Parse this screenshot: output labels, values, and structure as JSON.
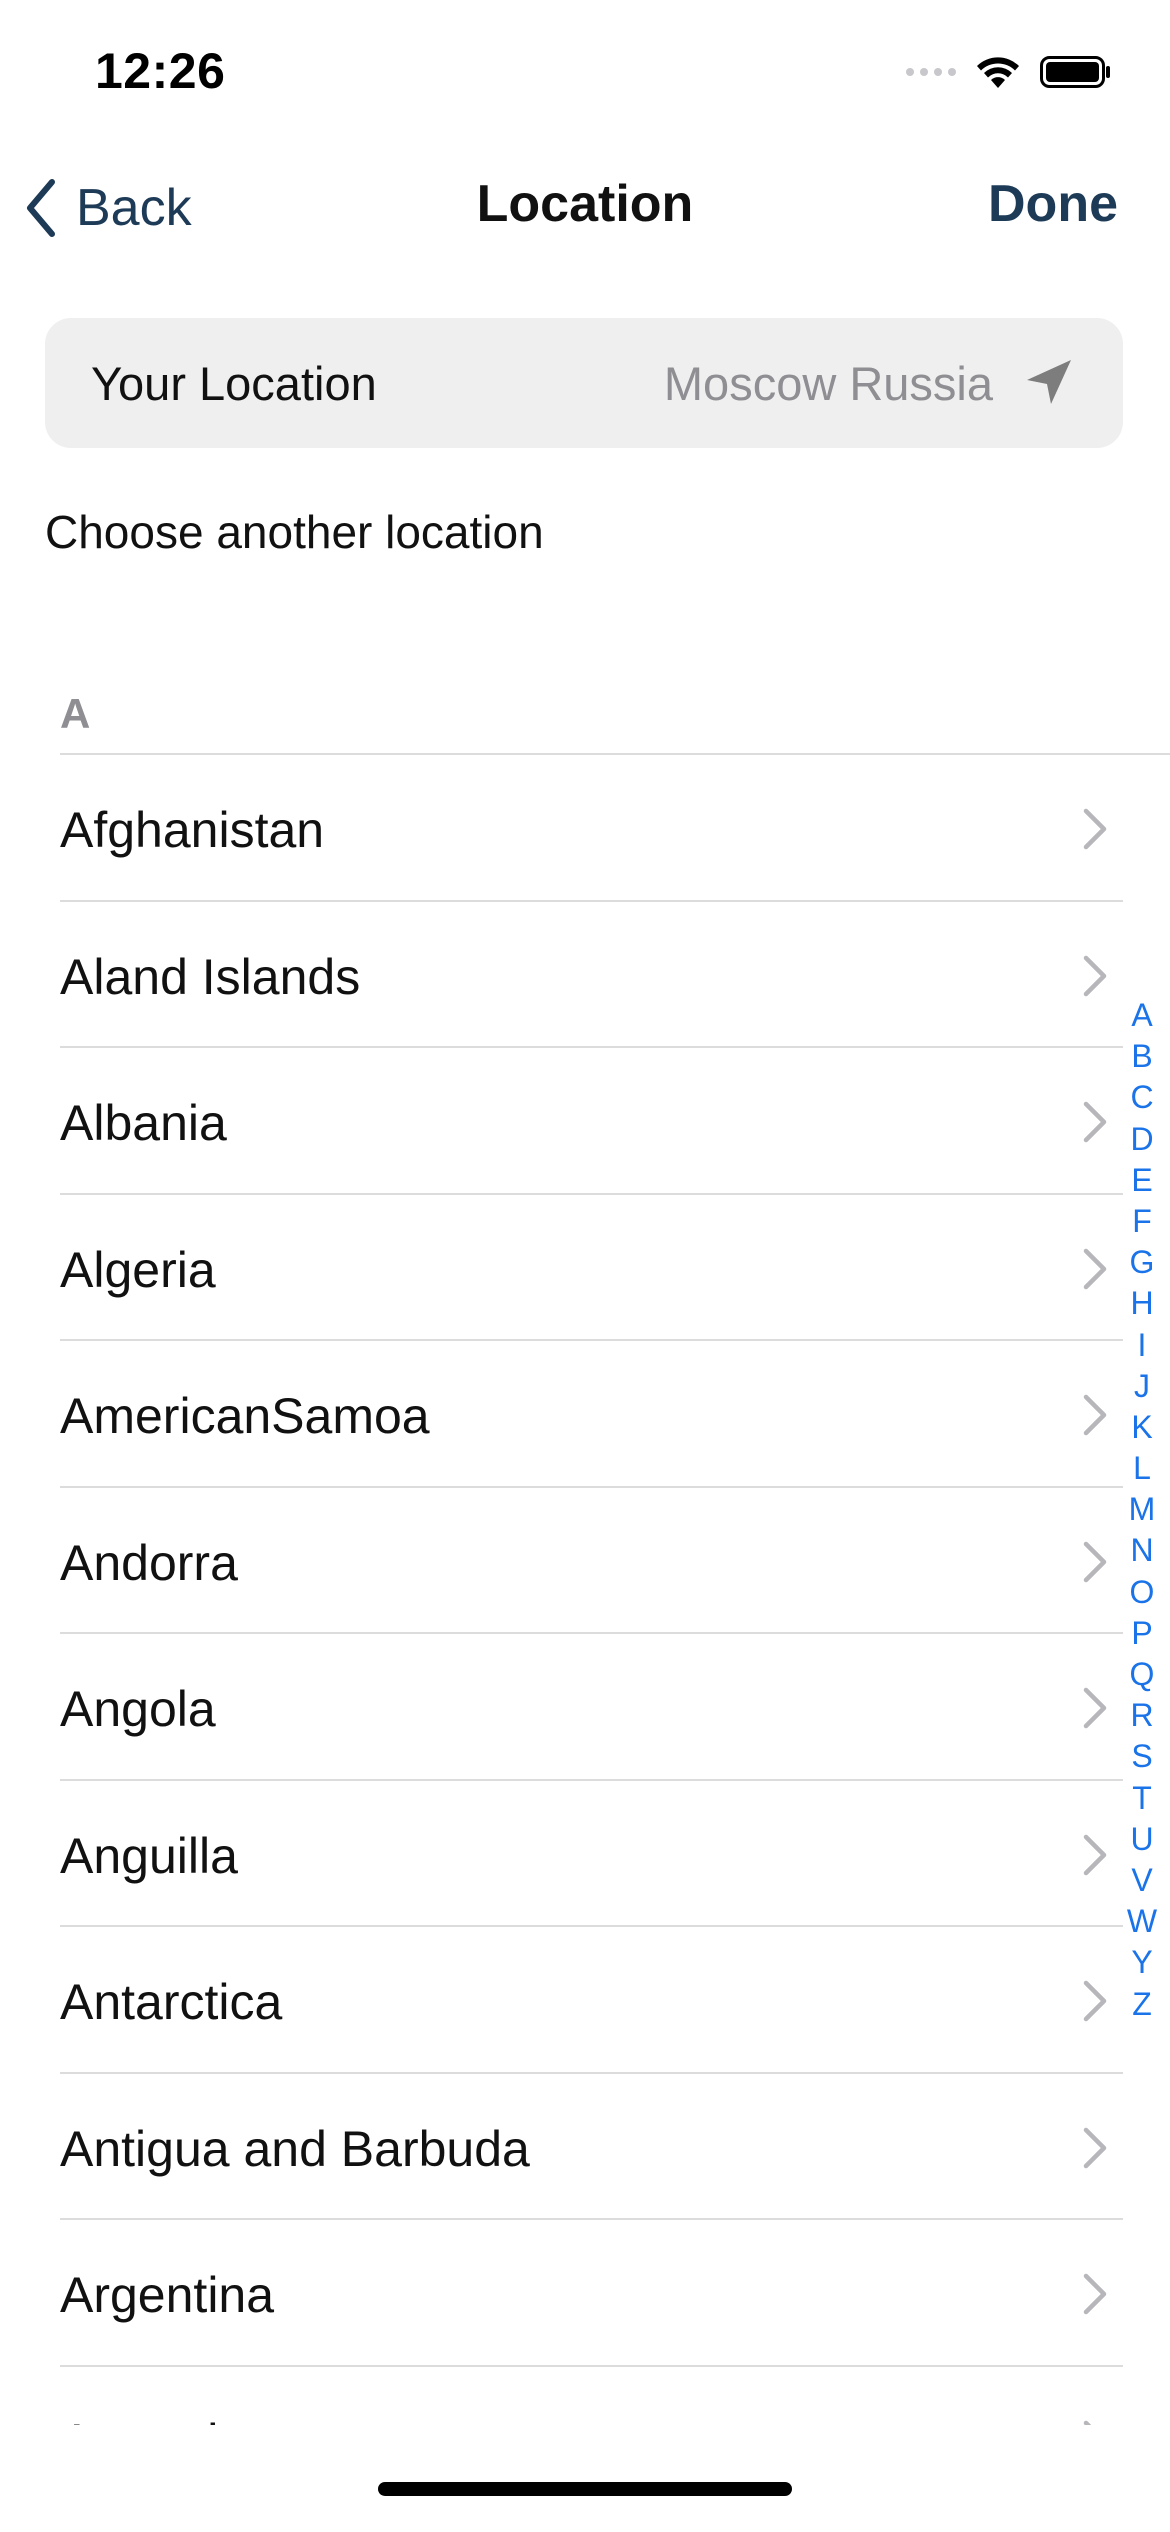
{
  "status_bar": {
    "time": "12:26"
  },
  "nav": {
    "back_label": "Back",
    "title": "Location",
    "done_label": "Done",
    "accent_color": "#1d3a57"
  },
  "your_location": {
    "label": "Your Location",
    "value": "Moscow Russia",
    "icon": "location-arrow-icon"
  },
  "choose_label": "Choose another location",
  "section": {
    "header": "A"
  },
  "countries": [
    "Afghanistan",
    "Aland Islands",
    "Albania",
    "Algeria",
    "AmericanSamoa",
    "Andorra",
    "Angola",
    "Anguilla",
    "Antarctica",
    "Antigua and Barbuda",
    "Argentina",
    "Armenia"
  ],
  "index_letters": [
    "A",
    "B",
    "C",
    "D",
    "E",
    "F",
    "G",
    "H",
    "I",
    "J",
    "K",
    "L",
    "M",
    "N",
    "O",
    "P",
    "Q",
    "R",
    "S",
    "T",
    "U",
    "V",
    "W",
    "Y",
    "Z"
  ],
  "index_color": "#1a73e8"
}
